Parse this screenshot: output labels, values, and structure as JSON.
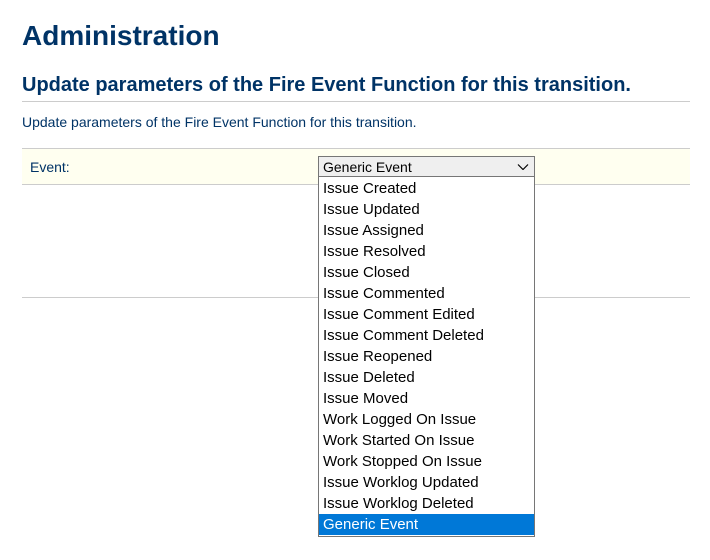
{
  "page": {
    "title": "Administration",
    "section_title": "Update parameters of the Fire Event Function for this transition.",
    "description": "Update parameters of the Fire Event Function for this transition."
  },
  "form": {
    "event": {
      "label": "Event:",
      "selected": "Generic Event",
      "options": [
        "Issue Created",
        "Issue Updated",
        "Issue Assigned",
        "Issue Resolved",
        "Issue Closed",
        "Issue Commented",
        "Issue Comment Edited",
        "Issue Comment Deleted",
        "Issue Reopened",
        "Issue Deleted",
        "Issue Moved",
        "Work Logged On Issue",
        "Work Started On Issue",
        "Work Stopped On Issue",
        "Issue Worklog Updated",
        "Issue Worklog Deleted",
        "Generic Event"
      ]
    }
  }
}
